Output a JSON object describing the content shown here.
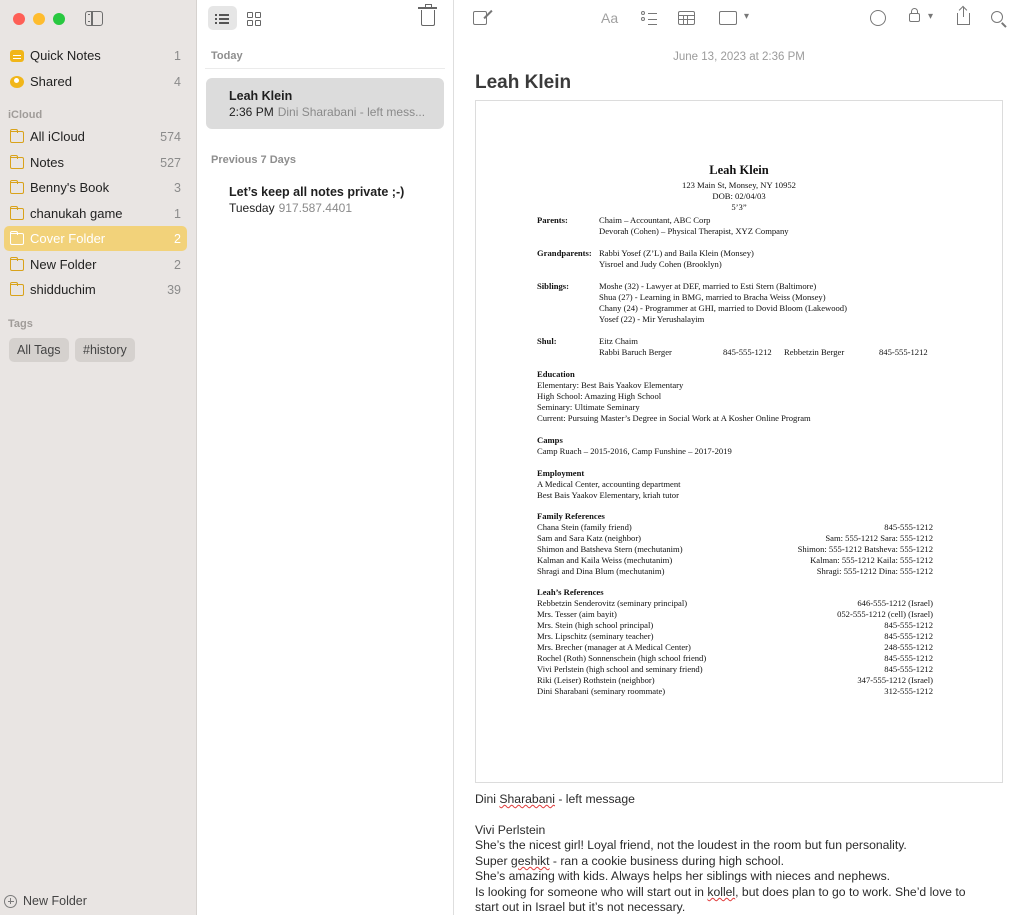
{
  "sidebar": {
    "pinned": [
      {
        "label": "Quick Notes",
        "count": "1",
        "icon": "quick-notes-icon"
      },
      {
        "label": "Shared",
        "count": "4",
        "icon": "shared-icon"
      }
    ],
    "section_icloud": "iCloud",
    "folders": [
      {
        "label": "All iCloud",
        "count": "574"
      },
      {
        "label": "Notes",
        "count": "527"
      },
      {
        "label": "Benny's Book",
        "count": "3"
      },
      {
        "label": "chanukah game",
        "count": "1"
      },
      {
        "label": "Cover Folder",
        "count": "2",
        "selected": true
      },
      {
        "label": "New Folder",
        "count": "2"
      },
      {
        "label": "shidduchim",
        "count": "39"
      }
    ],
    "section_tags": "Tags",
    "tags": [
      "All Tags",
      "#history"
    ],
    "new_folder": "New Folder",
    "accent": "#f2d27a"
  },
  "list": {
    "section_today": "Today",
    "section_prev": "Previous 7 Days",
    "notes": [
      {
        "title": "Leah Klein",
        "time": "2:36 PM",
        "preview": "Dini Sharabani - left mess...",
        "selected": true
      },
      {
        "title": "Let’s keep all notes private ;-)",
        "time": "Tuesday",
        "preview": "917.587.4401"
      }
    ]
  },
  "editor": {
    "toolbar": {
      "format_label": "Aa"
    },
    "date": "June 13, 2023 at 2:36 PM",
    "heading": "Leah Klein",
    "doc": {
      "name": "Leah Klein",
      "address": "123 Main St, Monsey, NY 10952",
      "dob": "DOB: 02/04/03",
      "height": "5’3”",
      "parents_label": "Parents:",
      "parents": [
        "Chaim – Accountant, ABC Corp",
        "Devorah (Cohen) – Physical Therapist, XYZ Company"
      ],
      "grandparents_label": "Grandparents:",
      "grandparents": [
        "Rabbi Yosef (Z’L) and Baila Klein (Monsey)",
        "Yisroel and Judy Cohen (Brooklyn)"
      ],
      "siblings_label": "Siblings:",
      "siblings": [
        "Moshe (32) - Lawyer at DEF, married to Esti Stern (Baltimore)",
        "Shua (27) - Learning in BMG, married to Bracha Weiss (Monsey)",
        "Chany (24) - Programmer at GHI, married to Dovid Bloom (Lakewood)",
        "Yosef (22) - Mir Yerushalayim"
      ],
      "shul_label": "Shul:",
      "shul": "Eitz Chaim",
      "rabbi": "Rabbi Baruch Berger",
      "rabbi_phone": "845-555-1212",
      "rebbetzin": "Rebbetzin Berger",
      "rebbetzin_phone": "845-555-1212",
      "education_label": "Education",
      "education": [
        "Elementary: Best Bais Yaakov Elementary",
        "High School: Amazing High School",
        "Seminary: Ultimate Seminary",
        "Current: Pursuing Master’s Degree in Social Work at A Kosher Online Program"
      ],
      "camps_label": "Camps",
      "camps": "Camp Ruach – 2015-2016, Camp Funshine – 2017-2019",
      "employment_label": "Employment",
      "employment": [
        "A Medical Center, accounting department",
        "Best Bais Yaakov Elementary, kriah tutor"
      ],
      "family_refs_label": "Family References",
      "family_refs": [
        {
          "name": "Chana Stein (family friend)",
          "phone": "845-555-1212"
        },
        {
          "name": "Sam and Sara Katz (neighbor)",
          "phone": "Sam: 555-1212 Sara: 555-1212"
        },
        {
          "name": "Shimon and Batsheva Stern (mechutanim)",
          "phone": "Shimon: 555-1212 Batsheva: 555-1212"
        },
        {
          "name": "Kalman and Kaila Weiss (mechutanim)",
          "phone": "Kalman: 555-1212 Kaila: 555-1212"
        },
        {
          "name": "Shragi and Dina Blum (mechutanim)",
          "phone": "Shragi: 555-1212 Dina: 555-1212"
        }
      ],
      "leah_refs_label": "Leah’s References",
      "leah_refs": [
        {
          "name": "Rebbetzin Senderovitz (seminary principal)",
          "phone": "646-555-1212 (Israel)"
        },
        {
          "name": "Mrs. Tesser (aim bayit)",
          "phone": "052-555-1212 (cell) (Israel)"
        },
        {
          "name": "Mrs. Stein (high school principal)",
          "phone": "845-555-1212"
        },
        {
          "name": "Mrs. Lipschitz (seminary teacher)",
          "phone": "845-555-1212"
        },
        {
          "name": "Mrs. Brecher (manager at A Medical Center)",
          "phone": "248-555-1212"
        },
        {
          "name": "Rochel (Roth) Sonnenschein (high school friend)",
          "phone": "845-555-1212"
        },
        {
          "name": "Vivi Perlstein (high school and seminary friend)",
          "phone": "845-555-1212"
        },
        {
          "name": "Riki (Leiser) Rothstein (neighbor)",
          "phone": "347-555-1212 (Israel)"
        },
        {
          "name": "Dini Sharabani (seminary roommate)",
          "phone": "312-555-1212"
        }
      ]
    },
    "body": {
      "line1_a": "Dini ",
      "line1_b": "Sharabani",
      "line1_c": "  - left message",
      "line2": "Vivi Perlstein",
      "line3": "She’s the nicest girl! Loyal friend, not the loudest in the room but fun personality.",
      "line4_a": "Super ",
      "line4_b": "geshikt",
      "line4_c": " - ran a cookie business during high school.",
      "line5": "She’s amazing with kids. Always helps her siblings with nieces and nephews.",
      "line6_a": "Is looking for someone who will start out in ",
      "line6_b": "kollel",
      "line6_c": ", but does plan to go to work. She’d love to",
      "line7": "start out in Israel but it’s not necessary."
    }
  }
}
